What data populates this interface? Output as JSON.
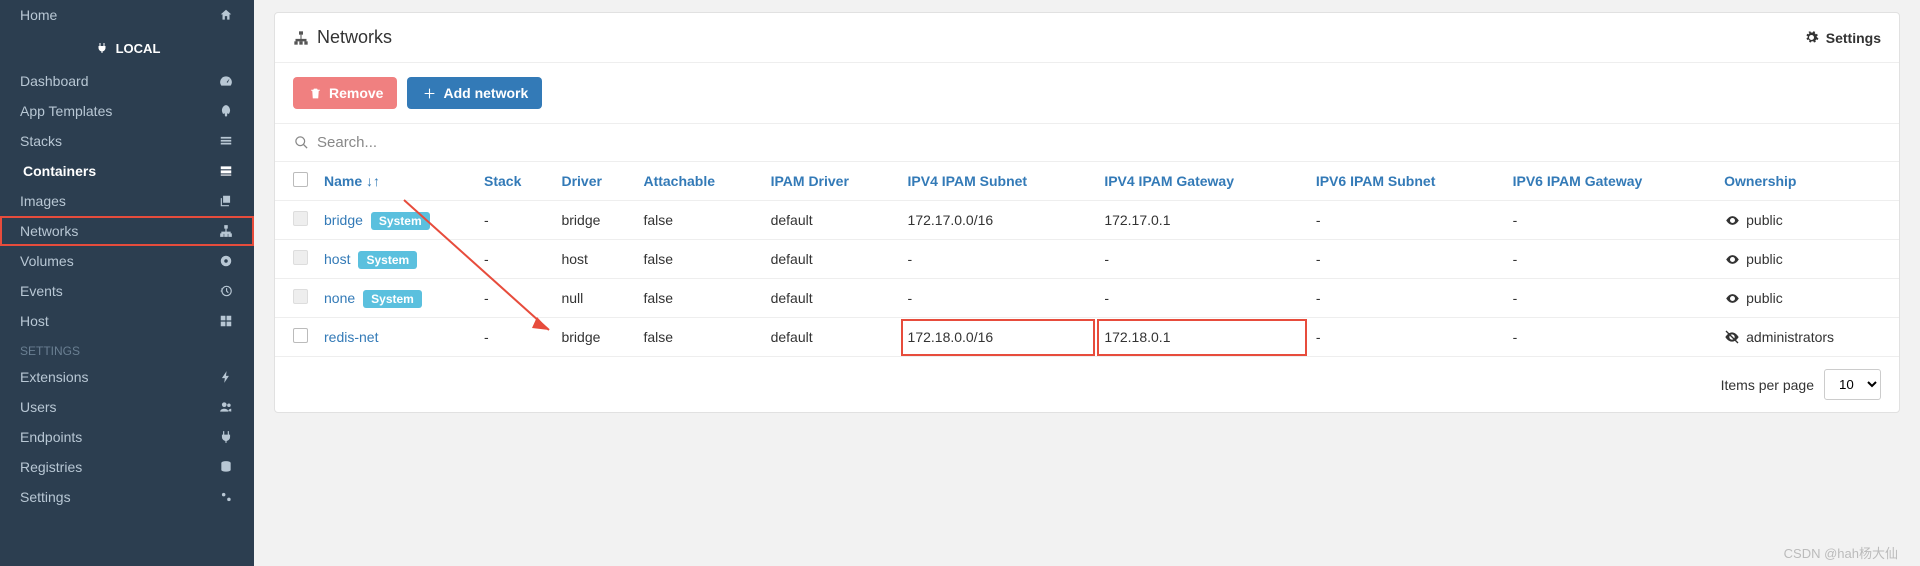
{
  "sidebar": {
    "home": "Home",
    "local_label": "LOCAL",
    "items": [
      {
        "label": "Dashboard"
      },
      {
        "label": "App Templates"
      },
      {
        "label": "Stacks"
      },
      {
        "label": "Containers"
      },
      {
        "label": "Images"
      },
      {
        "label": "Networks"
      },
      {
        "label": "Volumes"
      },
      {
        "label": "Events"
      },
      {
        "label": "Host"
      }
    ],
    "settings_header": "SETTINGS",
    "settings": [
      {
        "label": "Extensions"
      },
      {
        "label": "Users"
      },
      {
        "label": "Endpoints"
      },
      {
        "label": "Registries"
      },
      {
        "label": "Settings"
      }
    ]
  },
  "panel": {
    "title": "Networks",
    "settings_label": "Settings",
    "remove_label": "Remove",
    "add_label": "Add network",
    "search_placeholder": "Search...",
    "items_per_page_label": "Items per page",
    "items_per_page_value": "10"
  },
  "table": {
    "headers": {
      "name": "Name",
      "stack": "Stack",
      "driver": "Driver",
      "attachable": "Attachable",
      "ipam_driver": "IPAM Driver",
      "ipv4_subnet": "IPV4 IPAM Subnet",
      "ipv4_gateway": "IPV4 IPAM Gateway",
      "ipv6_subnet": "IPV6 IPAM Subnet",
      "ipv6_gateway": "IPV6 IPAM Gateway",
      "ownership": "Ownership"
    },
    "badge_system": "System",
    "rows": [
      {
        "name": "bridge",
        "system": true,
        "stack": "-",
        "driver": "bridge",
        "attachable": "false",
        "ipam_driver": "default",
        "ipv4_subnet": "172.17.0.0/16",
        "ipv4_gateway": "172.17.0.1",
        "ipv6_subnet": "-",
        "ipv6_gateway": "-",
        "ownership": "public",
        "ownership_icon": "eye"
      },
      {
        "name": "host",
        "system": true,
        "stack": "-",
        "driver": "host",
        "attachable": "false",
        "ipam_driver": "default",
        "ipv4_subnet": "-",
        "ipv4_gateway": "-",
        "ipv6_subnet": "-",
        "ipv6_gateway": "-",
        "ownership": "public",
        "ownership_icon": "eye"
      },
      {
        "name": "none",
        "system": true,
        "stack": "-",
        "driver": "null",
        "attachable": "false",
        "ipam_driver": "default",
        "ipv4_subnet": "-",
        "ipv4_gateway": "-",
        "ipv6_subnet": "-",
        "ipv6_gateway": "-",
        "ownership": "public",
        "ownership_icon": "eye"
      },
      {
        "name": "redis-net",
        "system": false,
        "stack": "-",
        "driver": "bridge",
        "attachable": "false",
        "ipam_driver": "default",
        "ipv4_subnet": "172.18.0.0/16",
        "ipv4_gateway": "172.18.0.1",
        "ipv6_subnet": "-",
        "ipv6_gateway": "-",
        "ownership": "administrators",
        "ownership_icon": "eye-slash",
        "highlight": true
      }
    ]
  },
  "watermark": "CSDN @hah杨大仙"
}
